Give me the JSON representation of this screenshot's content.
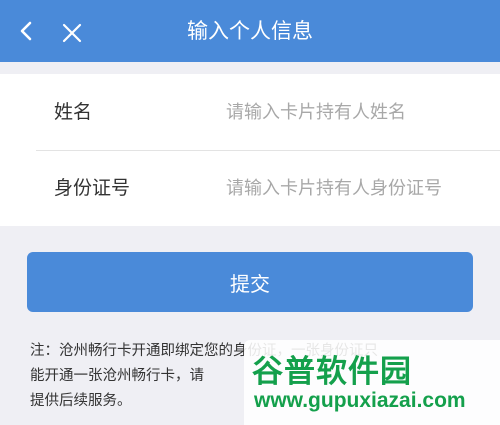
{
  "header": {
    "title": "输入个人信息",
    "back_icon": "chevron-left-icon",
    "close_icon": "close-icon"
  },
  "form": {
    "name_field": {
      "label": "姓名",
      "placeholder": "请输入卡片持有人姓名",
      "value": ""
    },
    "id_field": {
      "label": "身份证号",
      "placeholder": "请输入卡片持有人身份证号",
      "value": ""
    }
  },
  "submit": {
    "label": "提交"
  },
  "note": {
    "line1": "注：沧州畅行卡开通即绑定您的身份证，一张身份证只",
    "line2": "能开通一张沧州畅行卡，请",
    "line3": "提供后续服务。"
  },
  "watermark": {
    "logo_text": "谷普软件园",
    "url": "www.gupuxiazai.com"
  },
  "colors": {
    "primary": "#4a8ad9",
    "background": "#efeff4",
    "watermark": "#14a04c"
  }
}
